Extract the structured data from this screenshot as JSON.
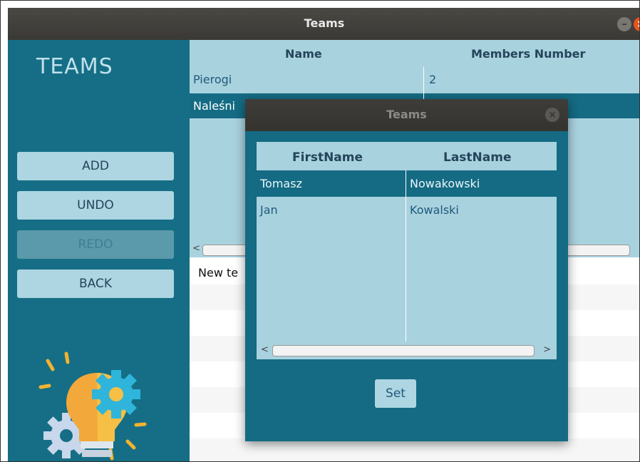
{
  "window": {
    "title": "Teams",
    "minimize_symbol": "–",
    "close_symbol": "×"
  },
  "sidebar": {
    "app_title": "TEAMS",
    "buttons": [
      {
        "label": "ADD",
        "enabled": true
      },
      {
        "label": "UNDO",
        "enabled": true
      },
      {
        "label": "REDO",
        "enabled": false
      },
      {
        "label": "BACK",
        "enabled": true
      }
    ],
    "logo_icon": "lightbulb-gears-icon"
  },
  "teams_table": {
    "columns": [
      "Name",
      "Members Number"
    ],
    "rows": [
      {
        "name": "Pierogi",
        "members": "2",
        "selected": false
      },
      {
        "name": "Naleśni",
        "members": "",
        "selected": true
      }
    ],
    "scroll_left": "<"
  },
  "new_team_input": {
    "value": "New te"
  },
  "dialog": {
    "title": "Teams",
    "close_symbol": "×",
    "columns": [
      "FirstName",
      "LastName"
    ],
    "rows": [
      {
        "first": "Tomasz",
        "last": "Nowakowski",
        "selected": true
      },
      {
        "first": "Jan",
        "last": "Kowalski",
        "selected": false
      }
    ],
    "scroll_left": "<",
    "scroll_right": ">",
    "set_label": "Set"
  },
  "colors": {
    "sidebar": "#156e85",
    "button": "#add5e2",
    "table": "#a9d2df",
    "selected_row": "#146b83",
    "close_button": "#e9541e"
  }
}
